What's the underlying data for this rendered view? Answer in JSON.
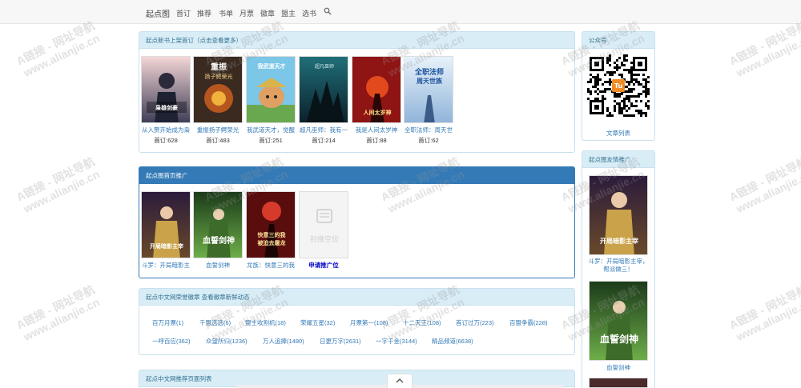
{
  "nav": {
    "brand": "起点图",
    "items": [
      "首订",
      "推荐",
      "书单",
      "月票",
      "徽章",
      "盟主",
      "选书"
    ],
    "search_icon": "search-icon"
  },
  "new_books": {
    "header": "起点新书上架首订（点击查看更多）",
    "books": [
      {
        "title": "从入赘开始成为枭",
        "subs": "首订:628",
        "cover_text": "从入赘开始成为枭雄剑豪"
      },
      {
        "title": "重振扬子鳄荣光",
        "subs": "首订:483",
        "cover_text": "重振扬子鳄荣光"
      },
      {
        "title": "我武道天才，觉醒",
        "subs": "首订:251",
        "cover_text": "我武道天才觉醒"
      },
      {
        "title": "超凡巫师：我有一",
        "subs": "首订:214",
        "cover_text": "超凡巫师"
      },
      {
        "title": "我是人间太岁神",
        "subs": "首订:88",
        "cover_text": "我是人间太岁神"
      },
      {
        "title": "全职法师：周天世",
        "subs": "首订:62",
        "cover_text": "全职法师周天世族"
      }
    ]
  },
  "homepage_promo": {
    "header": "起点图首页推广",
    "books": [
      {
        "title": "斗罗：开局暗影主",
        "cover_text": "开局暗影主宰"
      },
      {
        "title": "血誓剑神",
        "cover_text": "血誓剑神"
      },
      {
        "title": "龙族：快意三的我",
        "cover_text": "快意三的我被迫去屠龙"
      },
      {
        "title": "申请推广位",
        "cover_text": "封推空位"
      }
    ]
  },
  "badges": {
    "header": "起点中文网荣誉徽章 查看徽章新鲜动态",
    "items": [
      [
        "百万月票(1)",
        "千盟选选(6)",
        "盟主收割机(18)",
        "荣耀五星(32)",
        "月票第一(108)",
        "十二天王(108)",
        "首订过万(223)",
        "百盟争霸(228)"
      ],
      [
        "一呼百应(362)",
        "众望所归(1236)",
        "万人追捧(1480)",
        "日更万字(2631)",
        "一字千金(3144)",
        "精品频道(6638)"
      ]
    ]
  },
  "recommend_list": {
    "header": "起点中文网推荐页面列表"
  },
  "sidebar": {
    "public_account": {
      "header": "公众号",
      "link": "文章列表",
      "qr_badge": "Tu"
    },
    "friends_promo": {
      "header": "起点图友情推广",
      "books": [
        {
          "title": "斗罗：开局暗影主宰，帮派做三！",
          "cover_text": "开局暗影主宰"
        },
        {
          "title": "血誓剑神",
          "cover_text": "血誓剑神"
        }
      ]
    }
  },
  "watermark": {
    "line1": "A链接 - 网址导航",
    "line2": "www.alianjie.cn"
  },
  "colors": {
    "panel_head": "#d9edf7",
    "panel_primary": "#337ab7",
    "link": "#337ab7"
  }
}
